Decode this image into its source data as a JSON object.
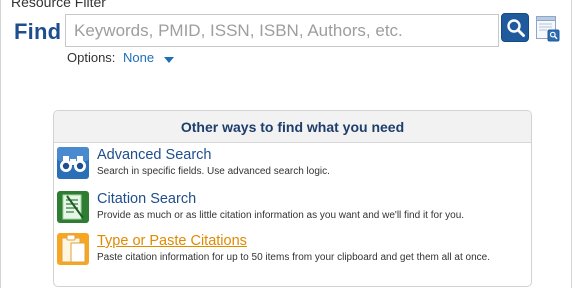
{
  "top_partial_text": "Resource Filter",
  "search": {
    "label": "Find",
    "placeholder": "Keywords, PMID, ISSN, ISBN, Authors, etc.",
    "value": ""
  },
  "options": {
    "label": "Options:",
    "value": "None"
  },
  "panel": {
    "title": "Other ways to find what you need",
    "items": [
      {
        "title": "Advanced Search",
        "description": "Search in specific fields. Use advanced search logic.",
        "icon": "binoculars-icon"
      },
      {
        "title": "Citation Search",
        "description": "Provide as much or as little citation information as you want and we'll find it for you.",
        "icon": "notepad-icon"
      },
      {
        "title": "Type or Paste Citations",
        "description": "Paste citation information for up to 50 items from your clipboard and get them all at once.",
        "icon": "clipboard-icon"
      }
    ]
  },
  "colors": {
    "brand_blue": "#1f4e8c",
    "link_blue": "#1e6fb8",
    "search_button": "#1f5a9c",
    "link_orange": "#e08a00",
    "panel_header_bg": "#f2f2f2"
  }
}
